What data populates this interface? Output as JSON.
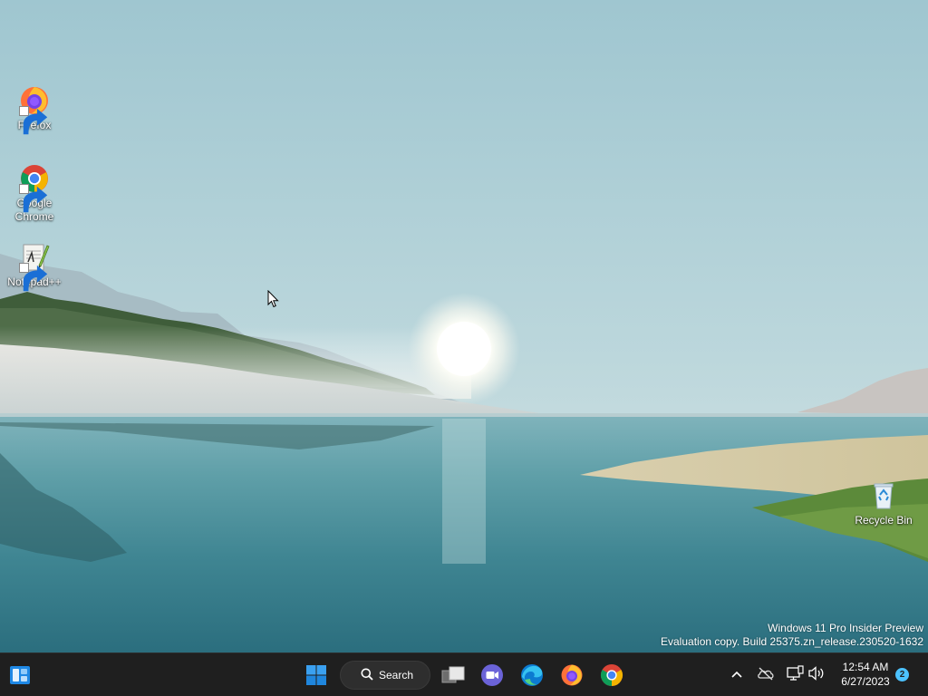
{
  "desktop": {
    "icons": [
      {
        "name": "firefox",
        "label": "Firefox"
      },
      {
        "name": "google-chrome",
        "label": "Google Chrome"
      },
      {
        "name": "notepad-plus-plus",
        "label": "Notepad++"
      },
      {
        "name": "recycle-bin",
        "label": "Recycle Bin"
      }
    ],
    "watermark": {
      "line1": "Windows 11 Pro Insider Preview",
      "line2": "Evaluation copy. Build 25375.zn_release.230520-1632"
    }
  },
  "taskbar": {
    "widgets_icon": "widgets-icon",
    "start_icon": "windows-start-icon",
    "search": {
      "label": "Search",
      "icon": "search-icon"
    },
    "pinned_apps": [
      {
        "name": "task-view",
        "icon": "task-view-icon"
      },
      {
        "name": "teams-meet",
        "icon": "teams-meet-icon"
      },
      {
        "name": "microsoft-edge",
        "icon": "edge-icon"
      },
      {
        "name": "firefox",
        "icon": "firefox-icon"
      },
      {
        "name": "google-chrome",
        "icon": "chrome-icon"
      }
    ],
    "tray": {
      "icons": [
        "chevron-up-icon",
        "onedrive-offline-icon",
        "network-icon",
        "volume-icon"
      ],
      "time": "12:54 AM",
      "date": "6/27/2023",
      "notification_count": "2"
    }
  },
  "colors": {
    "taskbar_bg": "#1f1f1f",
    "accent": "#4cc2ff",
    "start_blue": "#0078d4"
  }
}
